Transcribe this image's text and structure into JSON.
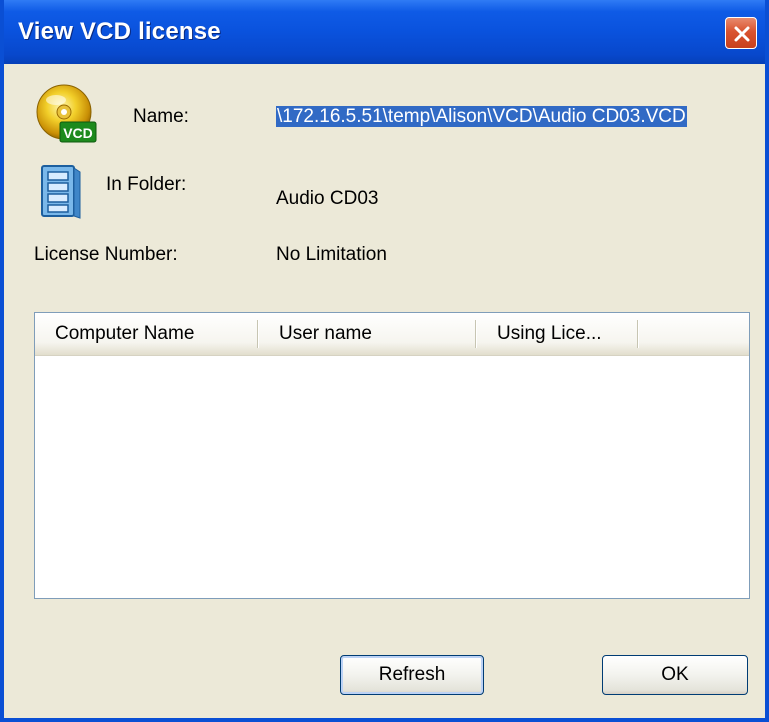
{
  "window": {
    "title": "View VCD license"
  },
  "fields": {
    "name_label": "Name:",
    "name_value": "\\172.16.5.51\\temp\\Alison\\VCD\\Audio CD03.VCD",
    "folder_label": "In Folder:",
    "folder_value": "Audio CD03",
    "license_label": "License Number:",
    "license_value": "No Limitation"
  },
  "icons": {
    "vcd": "vcd-disc-icon",
    "folder": "cabinet-icon",
    "close": "close-icon",
    "vcd_badge": "VCD"
  },
  "table": {
    "columns": [
      "Computer Name",
      "User name",
      "Using Lice..."
    ],
    "rows": []
  },
  "buttons": {
    "refresh": "Refresh",
    "ok": "OK"
  },
  "colors": {
    "titlebar": "#0a52dd",
    "selection": "#316ac5",
    "dialog_bg": "#ece9d8",
    "close": "#d9532f"
  }
}
